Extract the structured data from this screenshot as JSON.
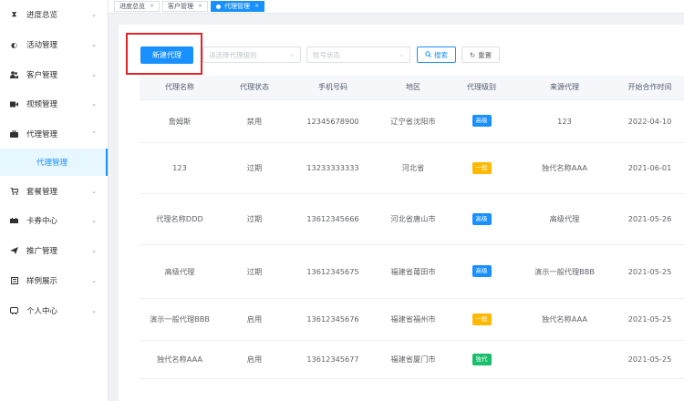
{
  "sidebar": {
    "items": [
      {
        "label": "进度总览",
        "icon": "hourglass-icon",
        "glyph": "⌛"
      },
      {
        "label": "活动管理",
        "icon": "activity-icon",
        "glyph": "◐"
      },
      {
        "label": "客户管理",
        "icon": "users-icon",
        "glyph": "👥"
      },
      {
        "label": "视频管理",
        "icon": "video-icon",
        "glyph": "■"
      },
      {
        "label": "代理管理",
        "icon": "briefcase-icon",
        "glyph": "▬"
      },
      {
        "label": "套餐管理",
        "icon": "cart-icon",
        "glyph": "🛒"
      },
      {
        "label": "卡券中心",
        "icon": "ticket-icon",
        "glyph": "▰"
      },
      {
        "label": "推广管理",
        "icon": "send-icon",
        "glyph": "➤"
      },
      {
        "label": "样例展示",
        "icon": "sample-icon",
        "glyph": "▣"
      },
      {
        "label": "个人中心",
        "icon": "user-center-icon",
        "glyph": "◒"
      }
    ],
    "submenu_label": "代理管理"
  },
  "tabs": [
    {
      "label": "进度总览"
    },
    {
      "label": "客户管理"
    },
    {
      "label": "代理管理"
    }
  ],
  "toolbar": {
    "new_label": "新建代理",
    "level_placeholder": "请选择代理级别",
    "status_placeholder": "账号状态",
    "search_label": "搜索",
    "reset_label": "重置"
  },
  "table": {
    "headers": [
      "代理名称",
      "代理状态",
      "手机号码",
      "地区",
      "代理级别",
      "来源代理",
      "开始合作时间"
    ],
    "rows": [
      {
        "name": "詹姆斯",
        "status": "禁用",
        "phone": "12345678900",
        "region": "辽宁省沈阳市",
        "level": "高级",
        "level_color": "blue",
        "source": "123",
        "date": "2022-04-10"
      },
      {
        "name": "123",
        "status": "过期",
        "phone": "13233333333",
        "region": "河北省",
        "level": "一般",
        "level_color": "orange",
        "source": "独代名称AAA",
        "date": "2021-06-01"
      },
      {
        "name": "代理名称DDD",
        "status": "过期",
        "phone": "13612345666",
        "region": "河北省唐山市",
        "level": "高级",
        "level_color": "blue",
        "source": "高级代理",
        "date": "2021-05-26"
      },
      {
        "name": "高级代理",
        "status": "过期",
        "phone": "13612345675",
        "region": "福建省莆田市",
        "level": "高级",
        "level_color": "blue",
        "source": "演示一般代理BBB",
        "date": "2021-05-25"
      },
      {
        "name": "演示一般代理BBB",
        "status": "启用",
        "phone": "13612345676",
        "region": "福建省福州市",
        "level": "一般",
        "level_color": "orange",
        "source": "独代名称AAA",
        "date": "2021-05-25"
      },
      {
        "name": "独代名称AAA",
        "status": "启用",
        "phone": "13612345677",
        "region": "福建省厦门市",
        "level": "独代",
        "level_color": "green",
        "source": "",
        "date": "2021-05-25"
      }
    ]
  },
  "colors": {
    "primary": "#1890ff",
    "warning": "#ffb800",
    "success": "#19be6b",
    "highlight": "#e0242a"
  }
}
